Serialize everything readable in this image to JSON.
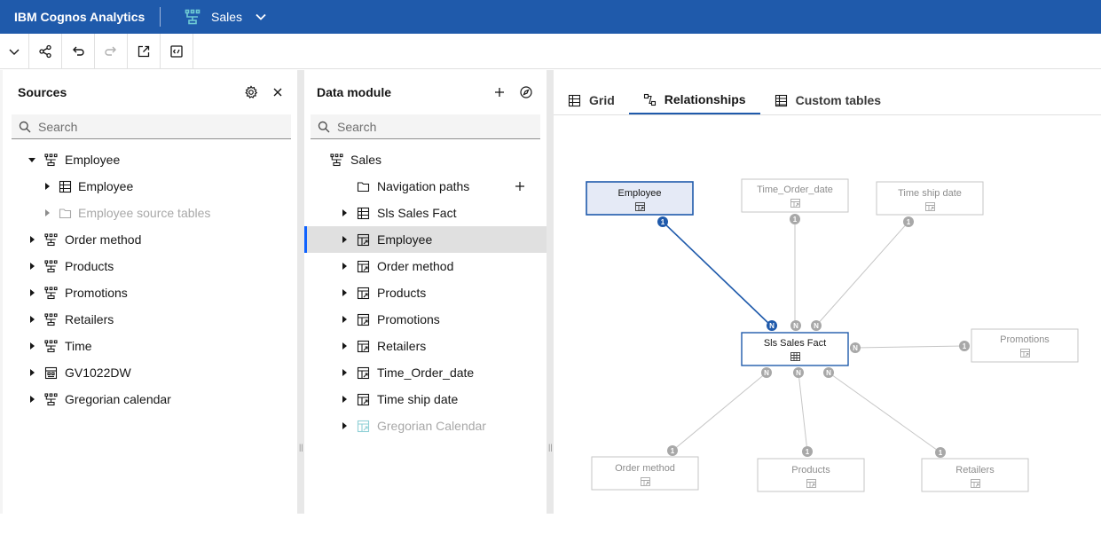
{
  "header": {
    "app_title": "IBM Cognos Analytics",
    "module_title": "Sales",
    "icons": [
      "data-module-icon",
      "chevron-down-icon"
    ]
  },
  "toolbar": {
    "icons": [
      "chevron-down-icon",
      "share-icon",
      "undo-icon",
      "redo-icon",
      "launch-icon",
      "validate-icon"
    ]
  },
  "sources": {
    "title": "Sources",
    "search_placeholder": "Search",
    "items": [
      {
        "label": "Employee",
        "level": 0,
        "expanded": true,
        "icon": "data-module-icon"
      },
      {
        "label": "Employee",
        "level": 1,
        "expanded": false,
        "icon": "table-icon"
      },
      {
        "label": "Employee source tables",
        "level": 1,
        "expanded": false,
        "icon": "folder-icon",
        "dim": true
      },
      {
        "label": "Order method",
        "level": 0,
        "icon": "data-module-icon"
      },
      {
        "label": "Products",
        "level": 0,
        "icon": "data-module-icon"
      },
      {
        "label": "Promotions",
        "level": 0,
        "icon": "data-module-icon"
      },
      {
        "label": "Retailers",
        "level": 0,
        "icon": "data-module-icon"
      },
      {
        "label": "Time",
        "level": 0,
        "icon": "data-module-icon"
      },
      {
        "label": "GV1022DW",
        "level": 0,
        "icon": "data-server-icon"
      },
      {
        "label": "Gregorian calendar",
        "level": 0,
        "icon": "data-module-icon"
      }
    ]
  },
  "data_module": {
    "title": "Data module",
    "search_placeholder": "Search",
    "root_label": "Sales",
    "items": [
      {
        "label": "Navigation paths",
        "icon": "folder-icon",
        "caret": false,
        "plus": true
      },
      {
        "label": "Sls Sales Fact",
        "icon": "table-icon",
        "caret": true
      },
      {
        "label": "Employee",
        "icon": "linked-table-icon",
        "caret": true,
        "selected": true
      },
      {
        "label": "Order method",
        "icon": "linked-table-icon",
        "caret": true
      },
      {
        "label": "Products",
        "icon": "linked-table-icon",
        "caret": true
      },
      {
        "label": "Promotions",
        "icon": "linked-table-icon",
        "caret": true
      },
      {
        "label": "Retailers",
        "icon": "linked-table-icon",
        "caret": true
      },
      {
        "label": "Time_Order_date",
        "icon": "linked-table-icon",
        "caret": true
      },
      {
        "label": "Time ship date",
        "icon": "linked-table-icon",
        "caret": true
      },
      {
        "label": "Gregorian Calendar",
        "icon": "linked-table-icon",
        "caret": true,
        "dim": true
      }
    ]
  },
  "relationships": {
    "tabs": [
      {
        "label": "Grid",
        "icon": "grid-icon",
        "active": false
      },
      {
        "label": "Relationships",
        "icon": "relationship-icon",
        "active": true
      },
      {
        "label": "Custom tables",
        "icon": "custom-table-icon",
        "active": false
      }
    ],
    "nodes": {
      "employee": "Employee",
      "time_order_date": "Time_Order_date",
      "time_ship_date": "Time ship date",
      "fact": "Sls Sales Fact",
      "promotions": "Promotions",
      "order_method": "Order method",
      "products": "Products",
      "retailers": "Retailers"
    },
    "cardinality": {
      "one": "1",
      "many": "N"
    },
    "colors": {
      "selected_edge": "#1f5aab",
      "edge": "#c6c6c6",
      "badge": "#a8a8a8",
      "selected_fill": "#e5eaf6"
    }
  }
}
